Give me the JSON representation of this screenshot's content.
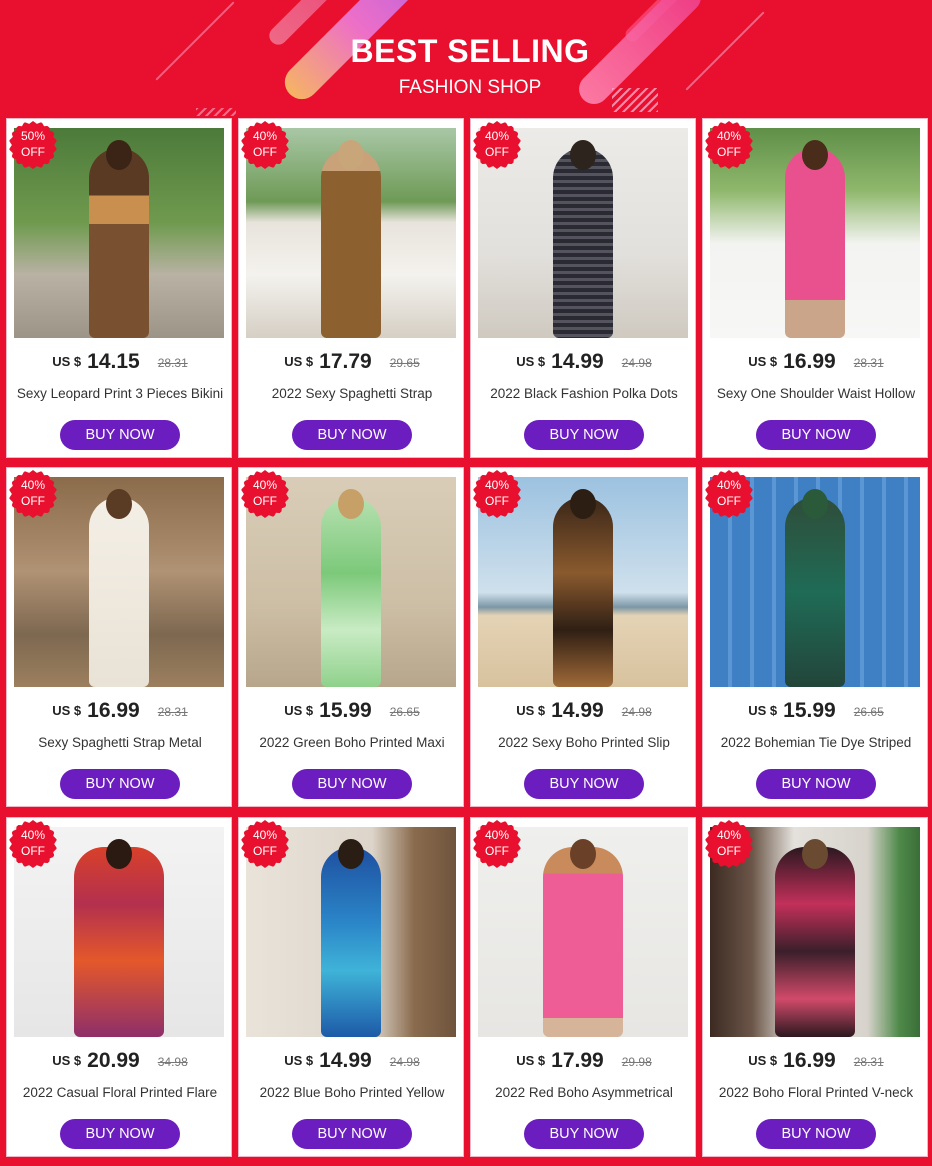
{
  "header": {
    "title": "BEST SELLING",
    "subtitle": "FASHION SHOP"
  },
  "colors": {
    "background": "#e8102e",
    "button": "#6b1dbf",
    "badge": "#e8102e"
  },
  "products": [
    {
      "badge_pct": "50%",
      "badge_off": "OFF",
      "currency": "US $",
      "price": "14.15",
      "old_price": "28.31",
      "name": "Sexy Leopard Print 3 Pieces Bikini",
      "button": "BUY NOW"
    },
    {
      "badge_pct": "40%",
      "badge_off": "OFF",
      "currency": "US $",
      "price": "17.79",
      "old_price": "29.65",
      "name": "2022 Sexy Spaghetti Strap",
      "button": "BUY NOW"
    },
    {
      "badge_pct": "40%",
      "badge_off": "OFF",
      "currency": "US $",
      "price": "14.99",
      "old_price": "24.98",
      "name": "2022 Black Fashion Polka Dots",
      "button": "BUY NOW"
    },
    {
      "badge_pct": "40%",
      "badge_off": "OFF",
      "currency": "US $",
      "price": "16.99",
      "old_price": "28.31",
      "name": "Sexy One Shoulder Waist Hollow",
      "button": "BUY NOW"
    },
    {
      "badge_pct": "40%",
      "badge_off": "OFF",
      "currency": "US $",
      "price": "16.99",
      "old_price": "28.31",
      "name": "Sexy Spaghetti Strap Metal",
      "button": "BUY NOW"
    },
    {
      "badge_pct": "40%",
      "badge_off": "OFF",
      "currency": "US $",
      "price": "15.99",
      "old_price": "26.65",
      "name": "2022 Green Boho Printed Maxi",
      "button": "BUY NOW"
    },
    {
      "badge_pct": "40%",
      "badge_off": "OFF",
      "currency": "US $",
      "price": "14.99",
      "old_price": "24.98",
      "name": "2022 Sexy Boho Printed Slip",
      "button": "BUY NOW"
    },
    {
      "badge_pct": "40%",
      "badge_off": "OFF",
      "currency": "US $",
      "price": "15.99",
      "old_price": "26.65",
      "name": "2022 Bohemian Tie Dye Striped",
      "button": "BUY NOW"
    },
    {
      "badge_pct": "40%",
      "badge_off": "OFF",
      "currency": "US $",
      "price": "20.99",
      "old_price": "34.98",
      "name": "2022 Casual Floral Printed Flare",
      "button": "BUY NOW"
    },
    {
      "badge_pct": "40%",
      "badge_off": "OFF",
      "currency": "US $",
      "price": "14.99",
      "old_price": "24.98",
      "name": "2022 Blue Boho Printed Yellow",
      "button": "BUY NOW"
    },
    {
      "badge_pct": "40%",
      "badge_off": "OFF",
      "currency": "US $",
      "price": "17.99",
      "old_price": "29.98",
      "name": "2022 Red Boho Asymmetrical",
      "button": "BUY NOW"
    },
    {
      "badge_pct": "40%",
      "badge_off": "OFF",
      "currency": "US $",
      "price": "16.99",
      "old_price": "28.31",
      "name": "2022 Boho Floral Printed V-neck",
      "button": "BUY NOW"
    }
  ]
}
